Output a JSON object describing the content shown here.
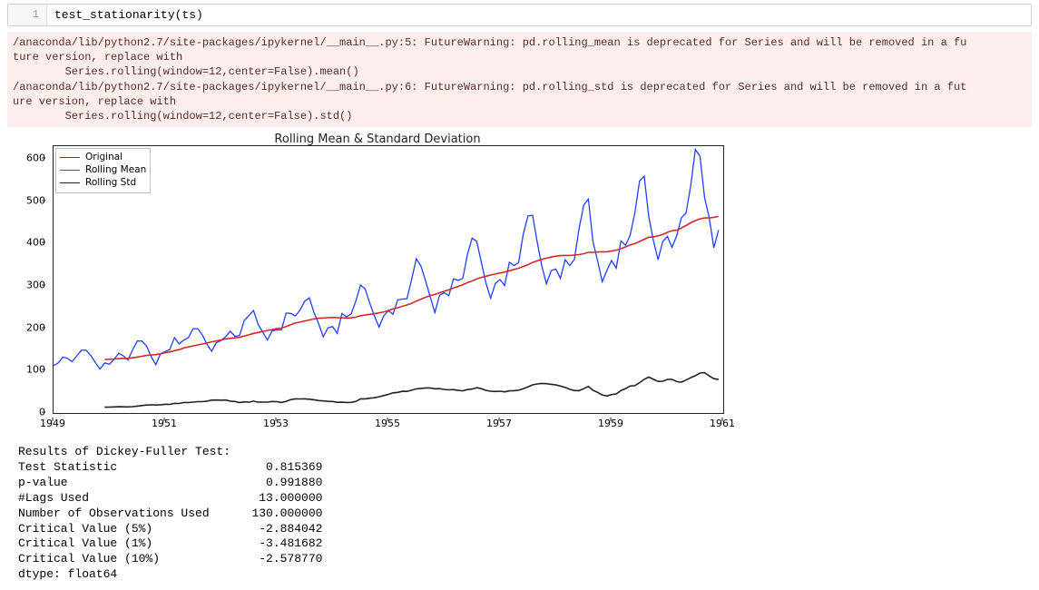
{
  "cell": {
    "prompt_number": "1",
    "code": "test_stationarity(ts)"
  },
  "warning_text": "/anaconda/lib/python2.7/site-packages/ipykernel/__main__.py:5: FutureWarning: pd.rolling_mean is deprecated for Series and will be removed in a fu\nture version, replace with \n\tSeries.rolling(window=12,center=False).mean()\n/anaconda/lib/python2.7/site-packages/ipykernel/__main__.py:6: FutureWarning: pd.rolling_std is deprecated for Series and will be removed in a fut\nure version, replace with \n\tSeries.rolling(window=12,center=False).std()",
  "chart_data": {
    "type": "line",
    "title": "Rolling Mean & Standard Deviation",
    "xlabel": "",
    "ylabel": "",
    "xlim": [
      1949,
      1961
    ],
    "ylim": [
      0,
      630
    ],
    "x_ticks": [
      1949,
      1951,
      1953,
      1955,
      1957,
      1959,
      1961
    ],
    "y_ticks": [
      0,
      100,
      200,
      300,
      400,
      500,
      600
    ],
    "x": [
      1949.0,
      1949.083,
      1949.167,
      1949.25,
      1949.333,
      1949.417,
      1949.5,
      1949.583,
      1949.667,
      1949.75,
      1949.833,
      1949.917,
      1950.0,
      1950.083,
      1950.167,
      1950.25,
      1950.333,
      1950.417,
      1950.5,
      1950.583,
      1950.667,
      1950.75,
      1950.833,
      1950.917,
      1951.0,
      1951.083,
      1951.167,
      1951.25,
      1951.333,
      1951.417,
      1951.5,
      1951.583,
      1951.667,
      1951.75,
      1951.833,
      1951.917,
      1952.0,
      1952.083,
      1952.167,
      1952.25,
      1952.333,
      1952.417,
      1952.5,
      1952.583,
      1952.667,
      1952.75,
      1952.833,
      1952.917,
      1953.0,
      1953.083,
      1953.167,
      1953.25,
      1953.333,
      1953.417,
      1953.5,
      1953.583,
      1953.667,
      1953.75,
      1953.833,
      1953.917,
      1954.0,
      1954.083,
      1954.167,
      1954.25,
      1954.333,
      1954.417,
      1954.5,
      1954.583,
      1954.667,
      1954.75,
      1954.833,
      1954.917,
      1955.0,
      1955.083,
      1955.167,
      1955.25,
      1955.333,
      1955.417,
      1955.5,
      1955.583,
      1955.667,
      1955.75,
      1955.833,
      1955.917,
      1956.0,
      1956.083,
      1956.167,
      1956.25,
      1956.333,
      1956.417,
      1956.5,
      1956.583,
      1956.667,
      1956.75,
      1956.833,
      1956.917,
      1957.0,
      1957.083,
      1957.167,
      1957.25,
      1957.333,
      1957.417,
      1957.5,
      1957.583,
      1957.667,
      1957.75,
      1957.833,
      1957.917,
      1958.0,
      1958.083,
      1958.167,
      1958.25,
      1958.333,
      1958.417,
      1958.5,
      1958.583,
      1958.667,
      1958.75,
      1958.833,
      1958.917,
      1959.0,
      1959.083,
      1959.167,
      1959.25,
      1959.333,
      1959.417,
      1959.5,
      1959.583,
      1959.667,
      1959.75,
      1959.833,
      1959.917,
      1960.0,
      1960.083,
      1960.167,
      1960.25,
      1960.333,
      1960.417,
      1960.5,
      1960.583,
      1960.667,
      1960.75,
      1960.833,
      1960.917
    ],
    "series": [
      {
        "name": "Original",
        "color": "#1f3fff",
        "values": [
          112,
          118,
          132,
          129,
          121,
          135,
          148,
          148,
          136,
          119,
          104,
          118,
          115,
          126,
          141,
          135,
          125,
          149,
          170,
          170,
          158,
          133,
          114,
          140,
          145,
          150,
          178,
          163,
          172,
          178,
          199,
          199,
          184,
          162,
          146,
          166,
          171,
          180,
          193,
          181,
          183,
          218,
          230,
          242,
          209,
          191,
          172,
          194,
          196,
          196,
          236,
          235,
          229,
          243,
          264,
          272,
          237,
          211,
          180,
          201,
          204,
          188,
          235,
          227,
          234,
          264,
          302,
          293,
          259,
          229,
          203,
          229,
          242,
          233,
          267,
          269,
          270,
          315,
          364,
          347,
          312,
          274,
          237,
          278,
          284,
          277,
          317,
          313,
          318,
          374,
          413,
          405,
          355,
          306,
          271,
          306,
          315,
          301,
          356,
          348,
          355,
          422,
          465,
          467,
          404,
          347,
          305,
          336,
          340,
          318,
          362,
          348,
          363,
          435,
          491,
          505,
          404,
          359,
          310,
          337,
          360,
          342,
          406,
          396,
          420,
          472,
          548,
          559,
          463,
          407,
          362,
          405,
          417,
          391,
          419,
          461,
          472,
          535,
          622,
          606,
          508,
          461,
          390,
          432
        ]
      },
      {
        "name": "Rolling Mean",
        "color": "#d62728",
        "values": [
          null,
          null,
          null,
          null,
          null,
          null,
          null,
          null,
          null,
          null,
          null,
          126.7,
          126.9,
          127.6,
          128.3,
          128.8,
          129.1,
          130.3,
          132.1,
          134.0,
          135.8,
          137.0,
          137.8,
          139.7,
          142.2,
          144.2,
          147.3,
          149.6,
          153.5,
          155.9,
          158.3,
          160.8,
          162.9,
          165.3,
          168.0,
          170.2,
          172.3,
          174.8,
          176.1,
          177.6,
          178.5,
          181.8,
          184.4,
          188.0,
          190.1,
          192.5,
          194.7,
          197.0,
          199.1,
          200.4,
          204.0,
          208.5,
          212.3,
          214.4,
          217.2,
          219.7,
          222.0,
          223.7,
          224.4,
          225.0,
          225.6,
          224.9,
          224.8,
          224.2,
          224.6,
          226.3,
          229.5,
          231.2,
          233.0,
          234.5,
          236.4,
          238.8,
          241.9,
          245.7,
          248.4,
          251.9,
          254.9,
          259.1,
          264.3,
          268.8,
          273.2,
          277.0,
          279.8,
          283.8,
          287.3,
          291.0,
          295.2,
          298.8,
          302.8,
          307.7,
          311.8,
          316.6,
          320.2,
          322.9,
          325.7,
          328.0,
          330.6,
          332.6,
          335.8,
          338.7,
          341.8,
          345.8,
          350.1,
          355.3,
          359.4,
          362.8,
          365.6,
          368.1,
          370.2,
          371.6,
          372.1,
          372.1,
          372.8,
          373.9,
          376.0,
          379.2,
          379.2,
          380.2,
          380.6,
          380.7,
          382.4,
          384.4,
          388.1,
          392.1,
          396.8,
          399.9,
          404.7,
          410.1,
          415.0,
          415.9,
          418.1,
          421.7,
          426.4,
          430.5,
          431.6,
          437.0,
          442.4,
          448.9,
          454.2,
          458.4,
          460.5,
          460.8,
          462.1,
          464.1
        ],
        "offset": 0
      },
      {
        "name": "Rolling Std",
        "color": "#222222",
        "values": [
          null,
          null,
          null,
          null,
          null,
          null,
          null,
          null,
          null,
          null,
          null,
          13.7,
          14.0,
          14.3,
          14.7,
          14.6,
          14.3,
          14.9,
          16.2,
          17.6,
          18.8,
          19.3,
          18.9,
          19.6,
          20.5,
          20.4,
          22.7,
          22.6,
          24.8,
          24.7,
          25.8,
          26.7,
          26.8,
          28.1,
          30.5,
          30.6,
          30.2,
          30.6,
          28.0,
          27.2,
          24.7,
          26.3,
          25.5,
          28.1,
          25.5,
          25.8,
          25.8,
          27.3,
          26.8,
          24.8,
          27.5,
          31.5,
          33.5,
          33.3,
          33.4,
          32.6,
          31.2,
          29.4,
          28.4,
          27.4,
          27.2,
          25.3,
          25.6,
          24.8,
          25.1,
          27.3,
          33.4,
          33.5,
          34.9,
          36.0,
          38.4,
          41.1,
          44.0,
          47.6,
          48.6,
          51.2,
          51.1,
          53.7,
          57.0,
          58.0,
          59.1,
          59.1,
          57.3,
          57.4,
          55.7,
          54.7,
          55.3,
          53.3,
          52.2,
          55.3,
          56.6,
          59.8,
          57.5,
          53.3,
          51.4,
          50.7,
          51.5,
          50.0,
          52.3,
          52.8,
          53.8,
          57.4,
          61.8,
          66.4,
          68.6,
          69.8,
          69.3,
          67.7,
          66.5,
          63.6,
          60.5,
          55.9,
          52.9,
          52.8,
          57.4,
          62.8,
          53.5,
          48.6,
          42.6,
          40.1,
          43.5,
          45.1,
          53.2,
          57.7,
          63.6,
          64.5,
          71.6,
          79.4,
          84.8,
          79.4,
          74.6,
          75.0,
          79.2,
          79.5,
          74.1,
          72.8,
          77.7,
          83.1,
          88.0,
          94.3,
          95.1,
          87.4,
          81.0,
          79.1,
          77.7
        ],
        "offset": 0
      }
    ],
    "legend": {
      "entries": [
        {
          "label": "Original",
          "color": "#1f3fff"
        },
        {
          "label": "Rolling Mean",
          "color": "#d62728"
        },
        {
          "label": "Rolling Std",
          "color": "#222222"
        }
      ]
    }
  },
  "adf_output": {
    "header": "Results of Dickey-Fuller Test:",
    "rows": [
      [
        "Test Statistic",
        "0.815369"
      ],
      [
        "p-value",
        "0.991880"
      ],
      [
        "#Lags Used",
        "13.000000"
      ],
      [
        "Number of Observations Used",
        "130.000000"
      ],
      [
        "Critical Value (5%)",
        "-2.884042"
      ],
      [
        "Critical Value (1%)",
        "-3.481682"
      ],
      [
        "Critical Value (10%)",
        "-2.578770"
      ]
    ],
    "dtype": "dtype: float64"
  }
}
